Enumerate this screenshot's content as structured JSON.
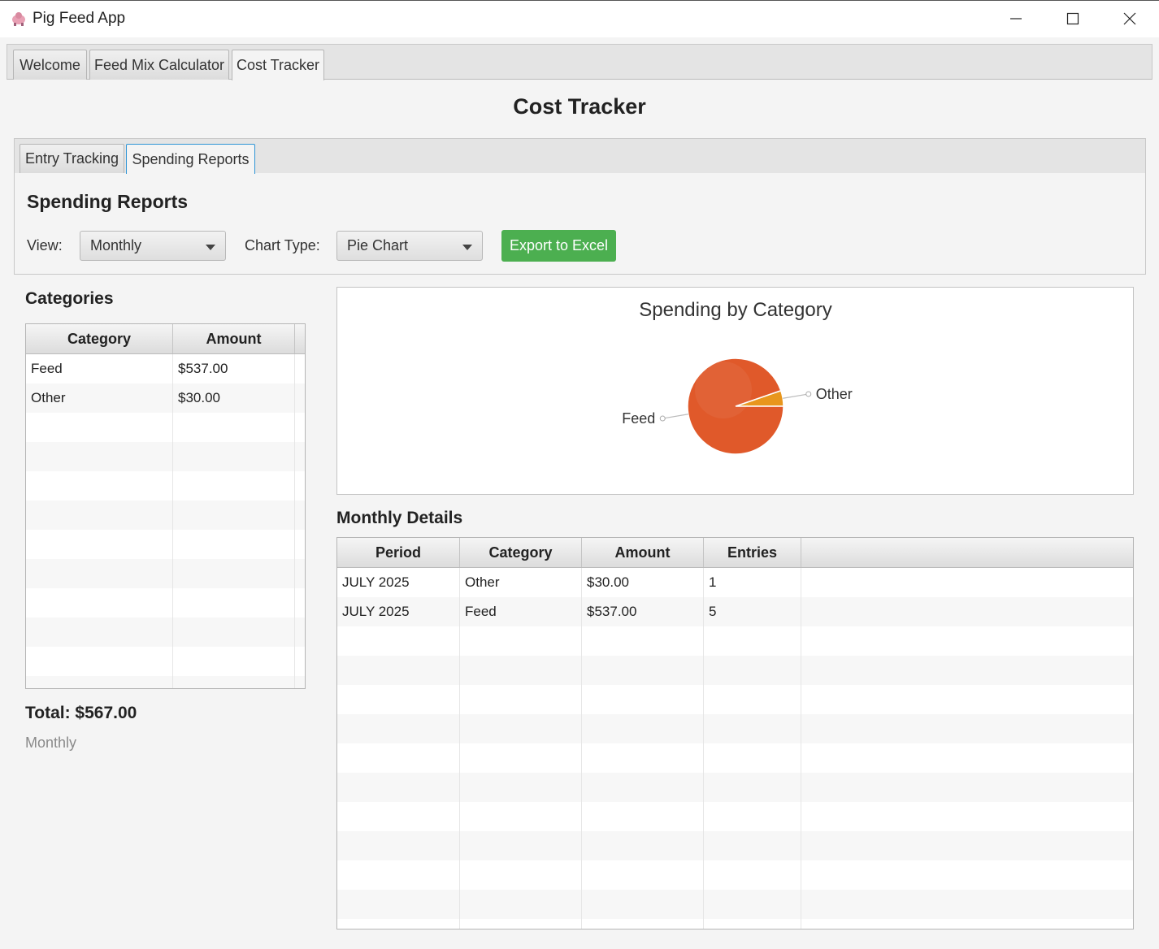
{
  "window": {
    "title": "Pig Feed App"
  },
  "main_tabs": [
    {
      "label": "Welcome"
    },
    {
      "label": "Feed Mix Calculator"
    },
    {
      "label": "Cost Tracker"
    }
  ],
  "page_title": "Cost Tracker",
  "sub_tabs": [
    {
      "label": "Entry Tracking"
    },
    {
      "label": "Spending Reports"
    }
  ],
  "reports": {
    "heading": "Spending Reports",
    "view_label": "View:",
    "view_value": "Monthly",
    "chart_type_label": "Chart Type:",
    "chart_type_value": "Pie Chart",
    "export_label": "Export to Excel",
    "export_color": "#4caf50"
  },
  "categories": {
    "heading": "Categories",
    "columns": [
      "Category",
      "Amount"
    ],
    "rows": [
      [
        "Feed",
        "$537.00"
      ],
      [
        "Other",
        "$30.00"
      ]
    ],
    "total": "Total: $567.00",
    "period": "Monthly"
  },
  "chart_data": {
    "type": "pie",
    "title": "Spending by Category",
    "slices": [
      {
        "label": "Feed",
        "value": 537,
        "color": "#e0592a"
      },
      {
        "label": "Other",
        "value": 30,
        "color": "#e8961d"
      }
    ]
  },
  "details": {
    "heading": "Monthly Details",
    "columns": [
      "Period",
      "Category",
      "Amount",
      "Entries"
    ],
    "rows": [
      [
        "JULY 2025",
        "Other",
        "$30.00",
        "1"
      ],
      [
        "JULY 2025",
        "Feed",
        "$537.00",
        "5"
      ]
    ]
  }
}
